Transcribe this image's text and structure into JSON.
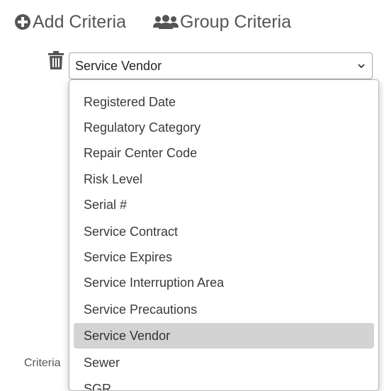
{
  "toolbar": {
    "add_label": "Add Criteria",
    "group_label": "Group Criteria"
  },
  "criteria_select": {
    "value": "Service Vendor"
  },
  "dropdown": {
    "options": [
      "Registered Date",
      "Regulatory Category",
      "Repair Center Code",
      "Risk Level",
      "Serial #",
      "Service Contract",
      "Service Expires",
      "Service Interruption Area",
      "Service Precautions",
      "Service Vendor",
      "Sewer",
      "SGR"
    ],
    "selected": "Service Vendor"
  },
  "side_label": "Criteria",
  "icons": {
    "add": "plus-circle-icon",
    "group": "users-icon",
    "delete": "trash-icon",
    "chevron": "chevron-down-icon"
  },
  "colors": {
    "highlight": "#d3d3d3",
    "text": "#555555",
    "border": "#a9a9a9"
  }
}
